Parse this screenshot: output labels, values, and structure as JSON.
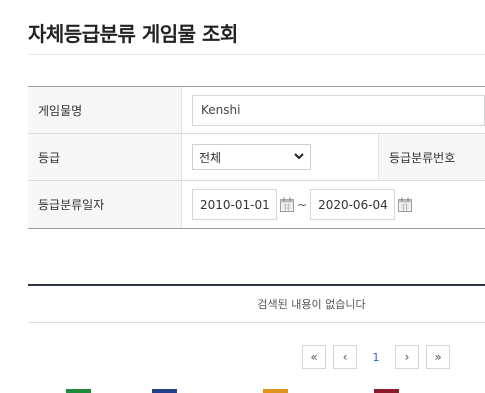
{
  "page": {
    "title": "자체등급분류 게임물 조회"
  },
  "form": {
    "game_name_label": "게임물명",
    "game_name_value": "Kenshi",
    "rating_label": "등급",
    "rating_selected": "전체",
    "rating_no_label": "등급분류번호",
    "date_label": "등급분류일자",
    "date_from": "2010-01-01",
    "date_separator": "~",
    "date_to": "2020-06-04"
  },
  "results": {
    "empty_message": "검색된 내용이 없습니다"
  },
  "pager": {
    "first": "«",
    "prev": "‹",
    "current": "1",
    "next": "›",
    "last": "»"
  },
  "icons": [
    "calendar-icon",
    "chevron-down-icon"
  ],
  "colors": {
    "rating_badge_green": "#1e8a3c",
    "rating_badge_blue": "#233f8c",
    "rating_badge_orange": "#e0931b",
    "rating_badge_red": "#8a1b2c"
  }
}
